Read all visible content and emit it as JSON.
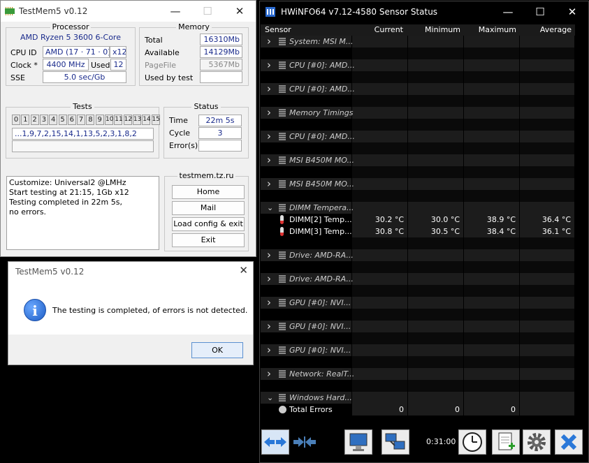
{
  "testmem": {
    "title": "TestMem5 v0.12",
    "processor": {
      "group_title": "Processor",
      "name": "AMD Ryzen 5 3600 6-Core",
      "cpuid_label": "CPU ID",
      "cpuid_value": "AMD  (17 · 71 · 0)",
      "threads": "x12",
      "clock_label": "Clock *",
      "clock_value": "4400 MHz",
      "used_label": "Used",
      "used_value": "12",
      "sse_label": "SSE",
      "sse_value": "5.0 sec/Gb"
    },
    "memory": {
      "group_title": "Memory",
      "total_label": "Total",
      "total_value": "16310Mb",
      "available_label": "Available",
      "available_value": "14129Mb",
      "pagefile_label": "PageFile",
      "pagefile_value": "5367Mb",
      "usedbytest_label": "Used by test",
      "usedbytest_value": ""
    },
    "tests": {
      "group_title": "Tests",
      "numbers": [
        "0",
        "1",
        "2",
        "3",
        "4",
        "5",
        "6",
        "7",
        "8",
        "9",
        "10",
        "11",
        "12",
        "13",
        "14",
        "15"
      ],
      "sequence": "...1,9,7,2,15,14,1,13,5,2,3,1,8,2",
      "bar": ""
    },
    "status": {
      "group_title": "Status",
      "time_label": "Time",
      "time_value": "22m 5s",
      "cycle_label": "Cycle",
      "cycle_value": "3",
      "errors_label": "Error(s)",
      "errors_value": ""
    },
    "log": [
      "Customize: Universal2 @LMHz",
      "Start testing at 21:15, 1Gb x12",
      "Testing completed in 22m 5s,",
      "no errors."
    ],
    "links": {
      "group_title": "testmem.tz.ru",
      "home": "Home",
      "mail": "Mail",
      "load": "Load config & exit",
      "exit": "Exit"
    }
  },
  "dialog": {
    "title": "TestMem5 v0.12",
    "message": "The testing is completed, of errors is not detected.",
    "ok": "OK"
  },
  "hwinfo": {
    "title": "HWiNFO64 v7.12-4580 Sensor Status",
    "columns": [
      "Sensor",
      "Current",
      "Minimum",
      "Maximum",
      "Average"
    ],
    "rows": [
      {
        "type": "sensor",
        "expanded": false,
        "name": "System: MSI M..."
      },
      {
        "type": "blank"
      },
      {
        "type": "sensor",
        "expanded": false,
        "name": "CPU [#0]: AMD..."
      },
      {
        "type": "blank"
      },
      {
        "type": "sensor",
        "expanded": false,
        "name": "CPU [#0]: AMD..."
      },
      {
        "type": "blank"
      },
      {
        "type": "sensor",
        "expanded": false,
        "name": "Memory Timings"
      },
      {
        "type": "blank"
      },
      {
        "type": "sensor",
        "expanded": false,
        "name": "CPU [#0]: AMD..."
      },
      {
        "type": "blank"
      },
      {
        "type": "sensor",
        "expanded": false,
        "name": "MSI B450M MO..."
      },
      {
        "type": "blank"
      },
      {
        "type": "sensor",
        "expanded": false,
        "name": "MSI B450M MO..."
      },
      {
        "type": "blank"
      },
      {
        "type": "sensor",
        "expanded": true,
        "name": "DIMM Tempera..."
      },
      {
        "type": "reading",
        "name": "DIMM[2] Temp...",
        "current": "30.2 °C",
        "minimum": "30.0 °C",
        "maximum": "38.9 °C",
        "average": "36.4 °C"
      },
      {
        "type": "reading",
        "name": "DIMM[3] Temp...",
        "current": "30.8 °C",
        "minimum": "30.5 °C",
        "maximum": "38.4 °C",
        "average": "36.1 °C"
      },
      {
        "type": "blank"
      },
      {
        "type": "sensor",
        "expanded": false,
        "name": "Drive: AMD-RA..."
      },
      {
        "type": "blank"
      },
      {
        "type": "sensor",
        "expanded": false,
        "name": "Drive: AMD-RA..."
      },
      {
        "type": "blank"
      },
      {
        "type": "sensor",
        "expanded": false,
        "name": "GPU [#0]: NVI..."
      },
      {
        "type": "blank"
      },
      {
        "type": "sensor",
        "expanded": false,
        "name": "GPU [#0]: NVI..."
      },
      {
        "type": "blank"
      },
      {
        "type": "sensor",
        "expanded": false,
        "name": "GPU [#0]: NVI..."
      },
      {
        "type": "blank"
      },
      {
        "type": "sensor",
        "expanded": false,
        "name": "Network: RealT..."
      },
      {
        "type": "blank"
      },
      {
        "type": "sensor",
        "expanded": true,
        "name": "Windows Hard..."
      },
      {
        "type": "total",
        "name": "Total Errors",
        "current": "0",
        "minimum": "0",
        "maximum": "0",
        "average": ""
      }
    ],
    "elapsed": "0:31:00"
  }
}
